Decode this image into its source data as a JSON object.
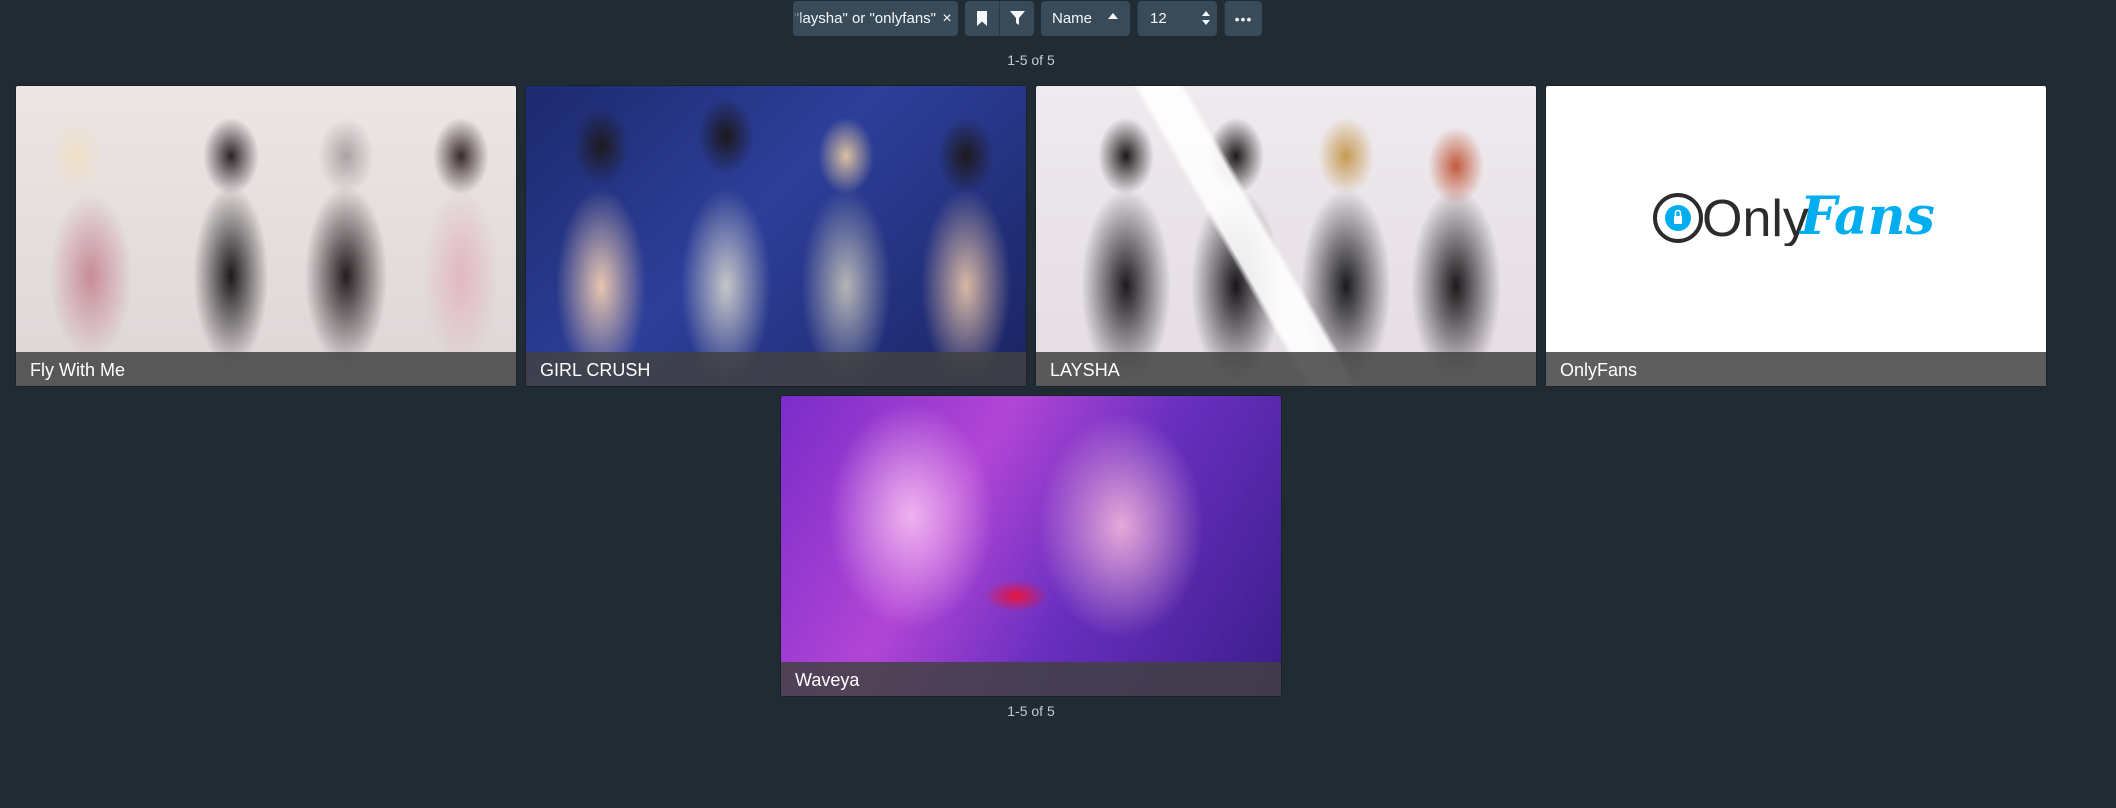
{
  "toolbar": {
    "search_value": "or \"laysha\" or \"onlyfans\"",
    "clear_glyph": "×",
    "saved_filter_icon": "bookmark-icon",
    "filter_icon": "filter-icon",
    "sort_label": "Name",
    "sort_direction_icon": "caret-up-icon",
    "per_page": "12",
    "more_label": "•••"
  },
  "pagination": {
    "top": "1-5 of 5",
    "bottom": "1-5 of 5"
  },
  "cards": [
    {
      "title": "Fly With Me"
    },
    {
      "title": "GIRL CRUSH"
    },
    {
      "title": "LAYSHA"
    },
    {
      "title": "OnlyFans",
      "logo": {
        "prefix": "Only",
        "suffix": "Fans"
      }
    },
    {
      "title": "Waveya"
    }
  ],
  "colors": {
    "background": "#202b33",
    "button": "#394b59",
    "card_title_bar": "#424242",
    "onlyfans_blue": "#00aeef"
  }
}
